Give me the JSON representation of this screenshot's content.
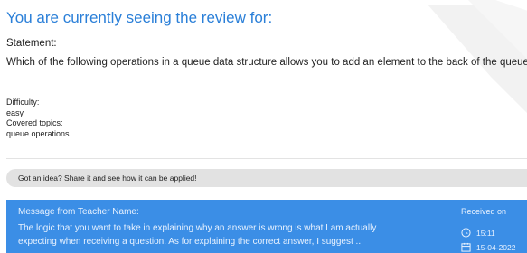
{
  "review": {
    "heading": "You are currently seeing the review for:",
    "statement_label": "Statement:",
    "statement_text": "Which of the following operations in a queue data structure allows you to add an element to the back of the queue?",
    "difficulty_label": "Difficulty:",
    "difficulty_value": "easy",
    "topics_label": "Covered topics:",
    "topics_value": "queue operations"
  },
  "idea_bar": {
    "text": "Got an idea? Share it and see how it can be applied!"
  },
  "message": {
    "from": "Message from Teacher Name:",
    "body_line1": "The logic that you want to take in explaining why an answer is wrong is what I am actually",
    "body_line2": "expecting when receiving a question. As for explaining the correct answer, I suggest ...",
    "received_label": "Received on",
    "time": "15:11",
    "date": "15-04-2022",
    "background_color": "#3b8ee6"
  },
  "colors": {
    "heading": "#2a7fd8",
    "idea_bar_bg": "#e2e2e2"
  }
}
